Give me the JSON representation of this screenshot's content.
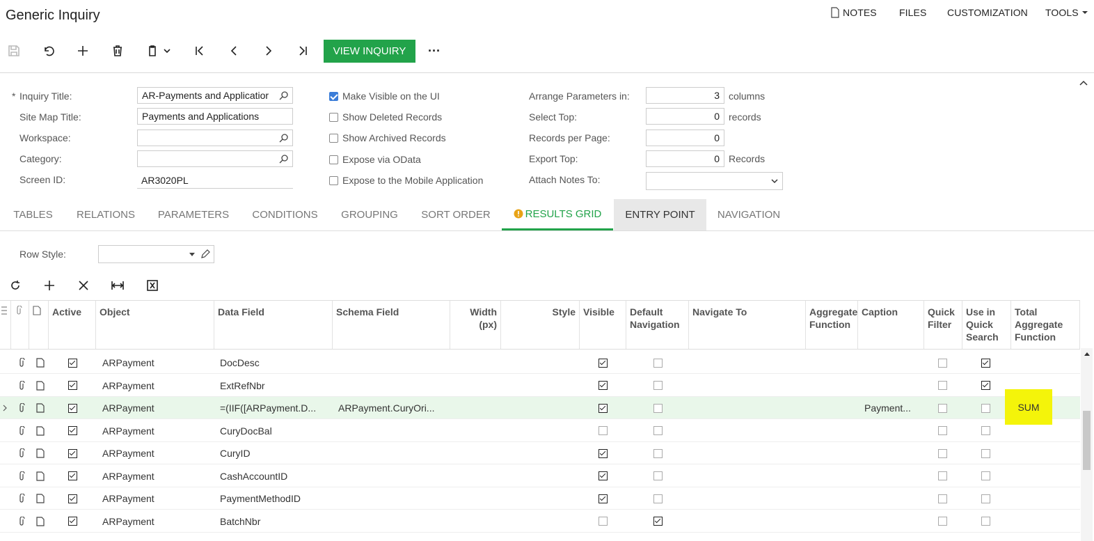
{
  "header": {
    "title": "Generic Inquiry",
    "menu": {
      "notes": "NOTES",
      "files": "FILES",
      "customization": "CUSTOMIZATION",
      "tools": "TOOLS"
    },
    "view_inquiry": "VIEW INQUIRY",
    "more": "···"
  },
  "form": {
    "required_mark": "*",
    "inquiry_title_label": "Inquiry Title:",
    "inquiry_title_value": "AR-Payments and Applicatior",
    "site_map_title_label": "Site Map Title:",
    "site_map_title_value": "Payments and Applications",
    "workspace_label": "Workspace:",
    "workspace_value": "",
    "category_label": "Category:",
    "category_value": "",
    "screen_id_label": "Screen ID:",
    "screen_id_value": "AR3020PL",
    "make_visible": "Make Visible on the UI",
    "show_deleted": "Show Deleted Records",
    "show_archived": "Show Archived Records",
    "expose_odata": "Expose via OData",
    "expose_mobile": "Expose to the Mobile Application",
    "arrange_label": "Arrange Parameters in:",
    "arrange_value": "3",
    "arrange_unit": "columns",
    "select_top_label": "Select Top:",
    "select_top_value": "0",
    "select_top_unit": "records",
    "records_per_page_label": "Records per Page:",
    "records_per_page_value": "0",
    "export_top_label": "Export Top:",
    "export_top_value": "0",
    "export_top_unit": "Records",
    "attach_notes_label": "Attach Notes To:",
    "attach_notes_value": ""
  },
  "tabs": [
    "TABLES",
    "RELATIONS",
    "PARAMETERS",
    "CONDITIONS",
    "GROUPING",
    "SORT ORDER",
    "RESULTS GRID",
    "ENTRY POINT",
    "NAVIGATION"
  ],
  "grid": {
    "row_style_label": "Row Style:",
    "headers": {
      "active": "Active",
      "object": "Object",
      "data_field": "Data Field",
      "schema_field": "Schema Field",
      "width": "Width (px)",
      "style": "Style",
      "visible": "Visible",
      "default_nav": "Default Navigation",
      "navigate_to": "Navigate To",
      "aggregate": "Aggregate Function",
      "caption": "Caption",
      "quick_filter": "Quick Filter",
      "use_quick_search": "Use in Quick Search",
      "total_aggregate": "Total Aggregate Function"
    },
    "rows": [
      {
        "object": "ARPayment",
        "data_field": "DocDesc",
        "schema_field": "",
        "caption": "",
        "total": "",
        "active": true,
        "visible": true,
        "default_nav": false,
        "quick_filter": false,
        "quick_search": true
      },
      {
        "object": "ARPayment",
        "data_field": "ExtRefNbr",
        "schema_field": "",
        "caption": "",
        "total": "",
        "active": true,
        "visible": true,
        "default_nav": false,
        "quick_filter": false,
        "quick_search": true
      },
      {
        "object": "ARPayment",
        "data_field": "=(IIF([ARPayment.D...",
        "schema_field": "ARPayment.CuryOri...",
        "caption": "Payment...",
        "total": "SUM",
        "active": true,
        "visible": true,
        "default_nav": false,
        "quick_filter": false,
        "quick_search": false
      },
      {
        "object": "ARPayment",
        "data_field": "CuryDocBal",
        "schema_field": "",
        "caption": "",
        "total": "",
        "active": true,
        "visible": false,
        "default_nav": false,
        "quick_filter": false,
        "quick_search": false
      },
      {
        "object": "ARPayment",
        "data_field": "CuryID",
        "schema_field": "",
        "caption": "",
        "total": "",
        "active": true,
        "visible": true,
        "default_nav": false,
        "quick_filter": false,
        "quick_search": false
      },
      {
        "object": "ARPayment",
        "data_field": "CashAccountID",
        "schema_field": "",
        "caption": "",
        "total": "",
        "active": true,
        "visible": true,
        "default_nav": false,
        "quick_filter": false,
        "quick_search": false
      },
      {
        "object": "ARPayment",
        "data_field": "PaymentMethodID",
        "schema_field": "",
        "caption": "",
        "total": "",
        "active": true,
        "visible": true,
        "default_nav": false,
        "quick_filter": false,
        "quick_search": false
      },
      {
        "object": "ARPayment",
        "data_field": "BatchNbr",
        "schema_field": "",
        "caption": "",
        "total": "",
        "active": true,
        "visible": false,
        "default_nav": true,
        "quick_filter": false,
        "quick_search": false
      }
    ]
  }
}
